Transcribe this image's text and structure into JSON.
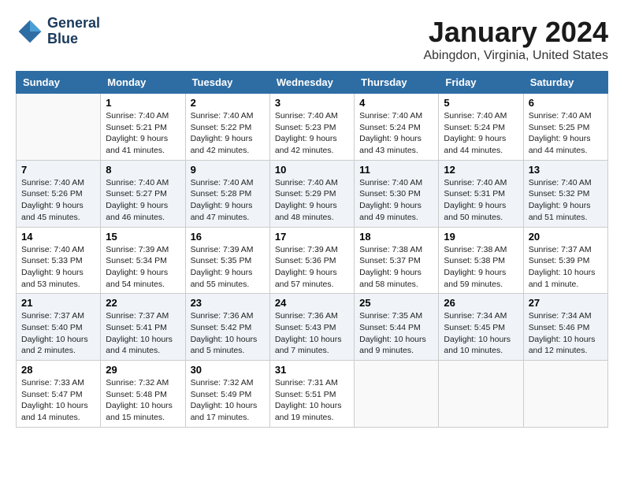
{
  "header": {
    "logo_line1": "General",
    "logo_line2": "Blue",
    "month": "January 2024",
    "location": "Abingdon, Virginia, United States"
  },
  "weekdays": [
    "Sunday",
    "Monday",
    "Tuesday",
    "Wednesday",
    "Thursday",
    "Friday",
    "Saturday"
  ],
  "weeks": [
    [
      {
        "day": "",
        "sunrise": "",
        "sunset": "",
        "daylight": ""
      },
      {
        "day": "1",
        "sunrise": "Sunrise: 7:40 AM",
        "sunset": "Sunset: 5:21 PM",
        "daylight": "Daylight: 9 hours and 41 minutes."
      },
      {
        "day": "2",
        "sunrise": "Sunrise: 7:40 AM",
        "sunset": "Sunset: 5:22 PM",
        "daylight": "Daylight: 9 hours and 42 minutes."
      },
      {
        "day": "3",
        "sunrise": "Sunrise: 7:40 AM",
        "sunset": "Sunset: 5:23 PM",
        "daylight": "Daylight: 9 hours and 42 minutes."
      },
      {
        "day": "4",
        "sunrise": "Sunrise: 7:40 AM",
        "sunset": "Sunset: 5:24 PM",
        "daylight": "Daylight: 9 hours and 43 minutes."
      },
      {
        "day": "5",
        "sunrise": "Sunrise: 7:40 AM",
        "sunset": "Sunset: 5:24 PM",
        "daylight": "Daylight: 9 hours and 44 minutes."
      },
      {
        "day": "6",
        "sunrise": "Sunrise: 7:40 AM",
        "sunset": "Sunset: 5:25 PM",
        "daylight": "Daylight: 9 hours and 44 minutes."
      }
    ],
    [
      {
        "day": "7",
        "sunrise": "Sunrise: 7:40 AM",
        "sunset": "Sunset: 5:26 PM",
        "daylight": "Daylight: 9 hours and 45 minutes."
      },
      {
        "day": "8",
        "sunrise": "Sunrise: 7:40 AM",
        "sunset": "Sunset: 5:27 PM",
        "daylight": "Daylight: 9 hours and 46 minutes."
      },
      {
        "day": "9",
        "sunrise": "Sunrise: 7:40 AM",
        "sunset": "Sunset: 5:28 PM",
        "daylight": "Daylight: 9 hours and 47 minutes."
      },
      {
        "day": "10",
        "sunrise": "Sunrise: 7:40 AM",
        "sunset": "Sunset: 5:29 PM",
        "daylight": "Daylight: 9 hours and 48 minutes."
      },
      {
        "day": "11",
        "sunrise": "Sunrise: 7:40 AM",
        "sunset": "Sunset: 5:30 PM",
        "daylight": "Daylight: 9 hours and 49 minutes."
      },
      {
        "day": "12",
        "sunrise": "Sunrise: 7:40 AM",
        "sunset": "Sunset: 5:31 PM",
        "daylight": "Daylight: 9 hours and 50 minutes."
      },
      {
        "day": "13",
        "sunrise": "Sunrise: 7:40 AM",
        "sunset": "Sunset: 5:32 PM",
        "daylight": "Daylight: 9 hours and 51 minutes."
      }
    ],
    [
      {
        "day": "14",
        "sunrise": "Sunrise: 7:40 AM",
        "sunset": "Sunset: 5:33 PM",
        "daylight": "Daylight: 9 hours and 53 minutes."
      },
      {
        "day": "15",
        "sunrise": "Sunrise: 7:39 AM",
        "sunset": "Sunset: 5:34 PM",
        "daylight": "Daylight: 9 hours and 54 minutes."
      },
      {
        "day": "16",
        "sunrise": "Sunrise: 7:39 AM",
        "sunset": "Sunset: 5:35 PM",
        "daylight": "Daylight: 9 hours and 55 minutes."
      },
      {
        "day": "17",
        "sunrise": "Sunrise: 7:39 AM",
        "sunset": "Sunset: 5:36 PM",
        "daylight": "Daylight: 9 hours and 57 minutes."
      },
      {
        "day": "18",
        "sunrise": "Sunrise: 7:38 AM",
        "sunset": "Sunset: 5:37 PM",
        "daylight": "Daylight: 9 hours and 58 minutes."
      },
      {
        "day": "19",
        "sunrise": "Sunrise: 7:38 AM",
        "sunset": "Sunset: 5:38 PM",
        "daylight": "Daylight: 9 hours and 59 minutes."
      },
      {
        "day": "20",
        "sunrise": "Sunrise: 7:37 AM",
        "sunset": "Sunset: 5:39 PM",
        "daylight": "Daylight: 10 hours and 1 minute."
      }
    ],
    [
      {
        "day": "21",
        "sunrise": "Sunrise: 7:37 AM",
        "sunset": "Sunset: 5:40 PM",
        "daylight": "Daylight: 10 hours and 2 minutes."
      },
      {
        "day": "22",
        "sunrise": "Sunrise: 7:37 AM",
        "sunset": "Sunset: 5:41 PM",
        "daylight": "Daylight: 10 hours and 4 minutes."
      },
      {
        "day": "23",
        "sunrise": "Sunrise: 7:36 AM",
        "sunset": "Sunset: 5:42 PM",
        "daylight": "Daylight: 10 hours and 5 minutes."
      },
      {
        "day": "24",
        "sunrise": "Sunrise: 7:36 AM",
        "sunset": "Sunset: 5:43 PM",
        "daylight": "Daylight: 10 hours and 7 minutes."
      },
      {
        "day": "25",
        "sunrise": "Sunrise: 7:35 AM",
        "sunset": "Sunset: 5:44 PM",
        "daylight": "Daylight: 10 hours and 9 minutes."
      },
      {
        "day": "26",
        "sunrise": "Sunrise: 7:34 AM",
        "sunset": "Sunset: 5:45 PM",
        "daylight": "Daylight: 10 hours and 10 minutes."
      },
      {
        "day": "27",
        "sunrise": "Sunrise: 7:34 AM",
        "sunset": "Sunset: 5:46 PM",
        "daylight": "Daylight: 10 hours and 12 minutes."
      }
    ],
    [
      {
        "day": "28",
        "sunrise": "Sunrise: 7:33 AM",
        "sunset": "Sunset: 5:47 PM",
        "daylight": "Daylight: 10 hours and 14 minutes."
      },
      {
        "day": "29",
        "sunrise": "Sunrise: 7:32 AM",
        "sunset": "Sunset: 5:48 PM",
        "daylight": "Daylight: 10 hours and 15 minutes."
      },
      {
        "day": "30",
        "sunrise": "Sunrise: 7:32 AM",
        "sunset": "Sunset: 5:49 PM",
        "daylight": "Daylight: 10 hours and 17 minutes."
      },
      {
        "day": "31",
        "sunrise": "Sunrise: 7:31 AM",
        "sunset": "Sunset: 5:51 PM",
        "daylight": "Daylight: 10 hours and 19 minutes."
      },
      {
        "day": "",
        "sunrise": "",
        "sunset": "",
        "daylight": ""
      },
      {
        "day": "",
        "sunrise": "",
        "sunset": "",
        "daylight": ""
      },
      {
        "day": "",
        "sunrise": "",
        "sunset": "",
        "daylight": ""
      }
    ]
  ]
}
